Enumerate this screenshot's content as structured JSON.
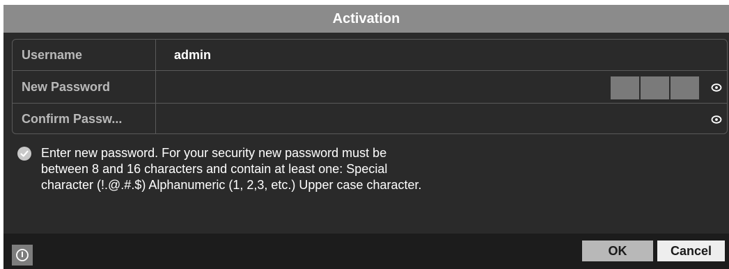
{
  "dialog": {
    "title": "Activation"
  },
  "form": {
    "username_label": "Username",
    "username_value": "admin",
    "new_password_label": "New Password",
    "new_password_value": "",
    "confirm_password_label": "Confirm Passw...",
    "confirm_password_value": "",
    "strength_segments": 3
  },
  "hint": {
    "text": "Enter new password. For your security new password must be between 8 and 16 characters and contain at least one: Special character (!.@.#.$) Alphanumeric (1, 2,3, etc.) Upper case character."
  },
  "footer": {
    "ok_label": "OK",
    "cancel_label": "Cancel"
  },
  "icons": {
    "eye": "eye-icon",
    "check": "check-circle-icon",
    "info": "info-icon"
  },
  "colors": {
    "title_bar": "#8b8b8b",
    "dialog_bg": "#2a2a2a",
    "ok_button": "#b8b8b8",
    "cancel_button": "#eeeeee"
  }
}
